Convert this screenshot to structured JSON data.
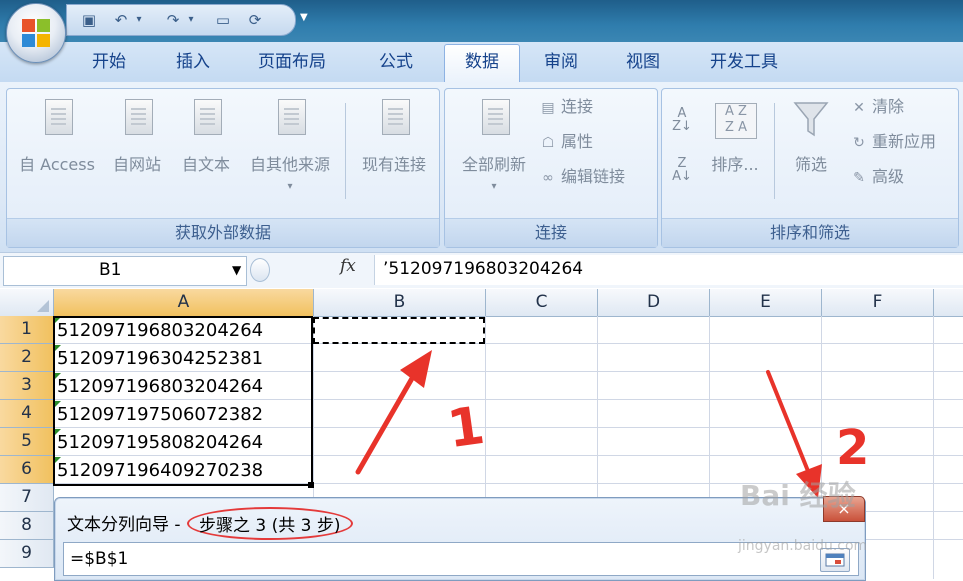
{
  "quick_access": {
    "icons": [
      "save-icon",
      "undo-icon",
      "redo-icon",
      "open-icon",
      "refresh-icon"
    ]
  },
  "tabs": [
    {
      "label": "开始"
    },
    {
      "label": "插入"
    },
    {
      "label": "页面布局"
    },
    {
      "label": "公式"
    },
    {
      "label": "数据",
      "active": true
    },
    {
      "label": "审阅"
    },
    {
      "label": "视图"
    },
    {
      "label": "开发工具"
    }
  ],
  "ribbon": {
    "external_data": {
      "label": "获取外部数据",
      "buttons": [
        "自 Access",
        "自网站",
        "自文本",
        "自其他来源",
        "现有连接"
      ]
    },
    "connections": {
      "label": "连接",
      "refresh_all": "全部刷新",
      "items": [
        "连接",
        "属性",
        "编辑链接"
      ]
    },
    "sort_filter": {
      "label": "排序和筛选",
      "sort": "排序...",
      "filter": "筛选",
      "items": [
        "清除",
        "重新应用",
        "高级"
      ]
    }
  },
  "formula_bar": {
    "name_box": "B1",
    "fx": "fx",
    "formula": "’512097196803204264"
  },
  "sheet": {
    "columns": [
      "A",
      "B",
      "C",
      "D",
      "E",
      "F"
    ],
    "rows": [
      "1",
      "2",
      "3",
      "4",
      "5",
      "6",
      "7",
      "8",
      "9"
    ],
    "column_a": [
      "512097196803204264",
      "512097196304252381",
      "512097196803204264",
      "512097197506072382",
      "512097195808204264",
      "512097196409270238"
    ]
  },
  "annotations": {
    "one": "1",
    "two": "2"
  },
  "dialog": {
    "title": "文本分列向导 -",
    "step": "步骤之 3 (共 3 步)",
    "input_value": "=$B$1",
    "close_label": "×"
  },
  "watermark": {
    "text": "Bai 经验",
    "sub": "jingyan.baidu.com"
  }
}
